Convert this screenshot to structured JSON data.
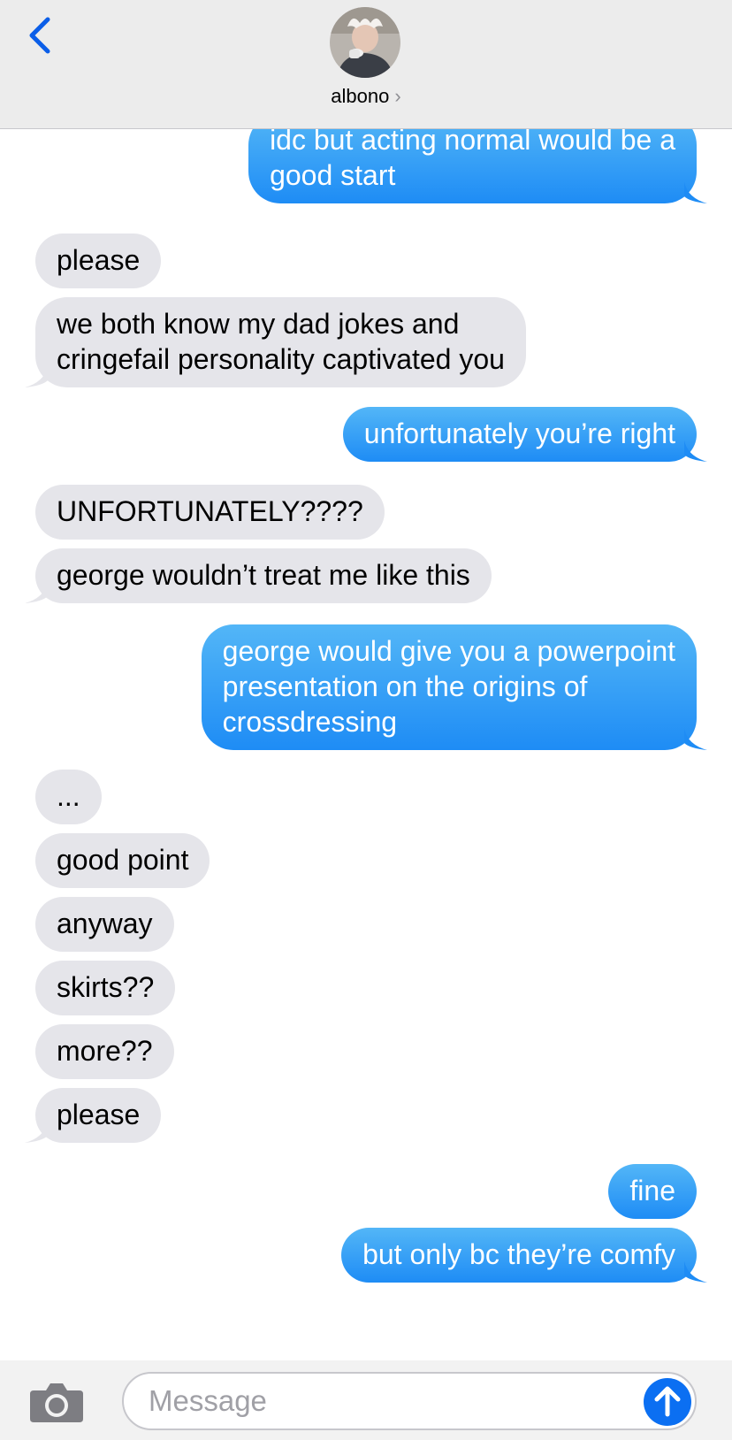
{
  "header": {
    "contact_name": "albono",
    "chevron": "›",
    "back_icon": "chevron-left-icon"
  },
  "messages": [
    {
      "side": "sent",
      "lines": [
        "idc but acting normal would be a",
        "good start"
      ],
      "tail": true
    },
    {
      "side": "recv",
      "lines": [
        "please"
      ],
      "tail": false
    },
    {
      "side": "recv",
      "lines": [
        "we both know my dad jokes and",
        "cringefail personality captivated you"
      ],
      "tail": true
    },
    {
      "side": "sent",
      "lines": [
        "unfortunately you’re right"
      ],
      "tail": true
    },
    {
      "side": "recv",
      "lines": [
        "UNFORTUNATELY????"
      ],
      "tail": false
    },
    {
      "side": "recv",
      "lines": [
        "george wouldn’t treat me like this"
      ],
      "tail": true
    },
    {
      "side": "sent",
      "lines": [
        "george would give you a powerpoint",
        "presentation on the origins of",
        "crossdressing"
      ],
      "tail": true
    },
    {
      "side": "recv",
      "lines": [
        "..."
      ],
      "tail": false
    },
    {
      "side": "recv",
      "lines": [
        "good point"
      ],
      "tail": false
    },
    {
      "side": "recv",
      "lines": [
        "anyway"
      ],
      "tail": false
    },
    {
      "side": "recv",
      "lines": [
        "skirts??"
      ],
      "tail": false
    },
    {
      "side": "recv",
      "lines": [
        "more??"
      ],
      "tail": false
    },
    {
      "side": "recv",
      "lines": [
        "please"
      ],
      "tail": true
    },
    {
      "side": "sent",
      "lines": [
        "fine"
      ],
      "tail": false
    },
    {
      "side": "sent",
      "lines": [
        "but only bc they’re comfy"
      ],
      "tail": true
    }
  ],
  "input": {
    "placeholder": "Message",
    "camera_icon": "camera-icon",
    "send_icon": "arrow-up-icon"
  },
  "colors": {
    "sent_top": "#53b6f7",
    "sent_bottom": "#1e8cf5",
    "received": "#e5e5ea",
    "accent": "#0b6ff2"
  }
}
